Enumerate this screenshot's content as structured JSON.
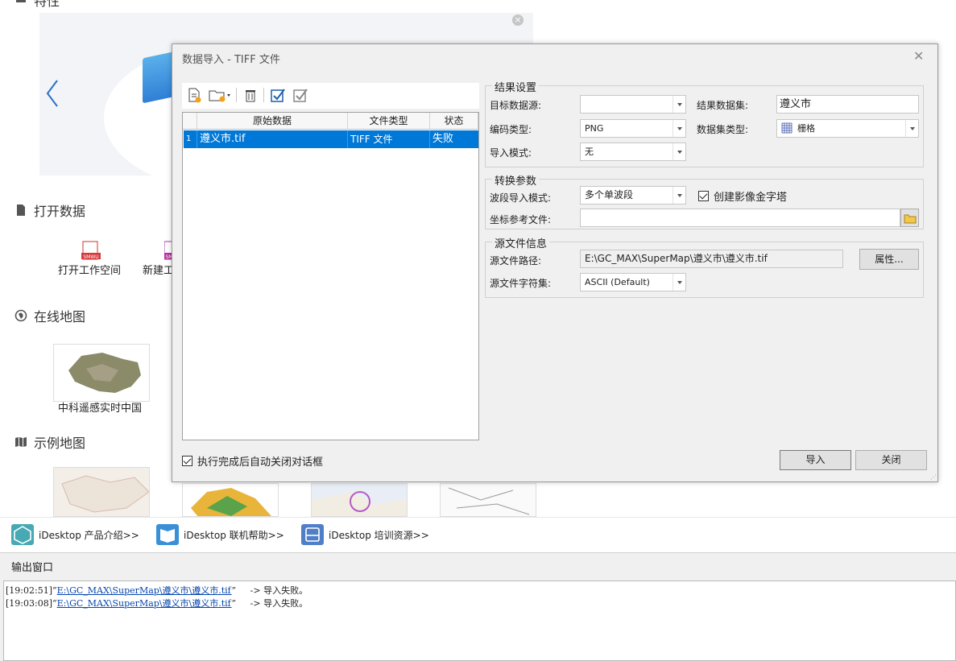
{
  "start_page": {
    "features_title": "特性",
    "open_data": {
      "title": "打开数据",
      "tiles": [
        {
          "label": "打开工作空间",
          "icon": "smwu-file-icon",
          "badge": "SMWU"
        },
        {
          "label": "新建工",
          "icon": "new-workspace-icon",
          "badge": "SM"
        }
      ]
    },
    "online_maps": {
      "title": "在线地图",
      "tiles": [
        {
          "label": "中科遥感实时中国"
        }
      ]
    },
    "sample_maps": {
      "title": "示例地图"
    }
  },
  "links_bar": {
    "items": [
      {
        "label": "iDesktop 产品介绍>>",
        "icon": "product-intro-icon",
        "color": "#46a9b3"
      },
      {
        "label": "iDesktop 联机帮助>>",
        "icon": "online-help-icon",
        "color": "#3a8fd6"
      },
      {
        "label": "iDesktop 培训资源>>",
        "icon": "training-resource-icon",
        "color": "#4f7fc6"
      }
    ]
  },
  "output_window": {
    "title": "输出窗口",
    "logs": [
      {
        "time": "[19:02:51]",
        "open_quote": "“",
        "path": "E:\\GC_MAX\\SuperMap\\遵义市\\遵义市.tif",
        "close_quote": "”",
        "message": "     -> 导入失败。"
      },
      {
        "time": "[19:03:08]",
        "open_quote": "“",
        "path": "E:\\GC_MAX\\SuperMap\\遵义市\\遵义市.tif",
        "close_quote": "”",
        "message": "     -> 导入失败。"
      }
    ]
  },
  "dialog": {
    "title": "数据导入 - TIFF 文件",
    "toolbar": {
      "add_file": "add-file-icon",
      "add_folder": "add-folder-icon",
      "delete": "delete-icon",
      "select_all": "select-all-icon",
      "select_invert": "select-invert-icon"
    },
    "grid": {
      "headers": [
        "原始数据",
        "文件类型",
        "状态"
      ],
      "rows": [
        {
          "index": "1",
          "name": "遵义市.tif",
          "type": "TIFF 文件",
          "status": "失败"
        }
      ]
    },
    "auto_close_label": "执行完成后自动关闭对话框",
    "auto_close_checked": true,
    "result_settings": {
      "legend": "结果设置",
      "target_datasource_label": "目标数据源:",
      "target_datasource_value": "",
      "result_dataset_label": "结果数据集:",
      "result_dataset_value": "遵义市",
      "encoding_label": "编码类型:",
      "encoding_value": "PNG",
      "dataset_type_label": "数据集类型:",
      "dataset_type_value": "栅格",
      "import_mode_label": "导入模式:",
      "import_mode_value": "无"
    },
    "conversion": {
      "legend": "转换参数",
      "band_mode_label": "波段导入模式:",
      "band_mode_value": "多个单波段",
      "pyramid_label": "创建影像金字塔",
      "pyramid_checked": true,
      "coord_file_label": "坐标参考文件:",
      "coord_file_value": ""
    },
    "source_info": {
      "legend": "源文件信息",
      "path_label": "源文件路径:",
      "path_value": "E:\\GC_MAX\\SuperMap\\遵义市\\遵义市.tif",
      "properties_button": "属性...",
      "charset_label": "源文件字符集:",
      "charset_value": "ASCII (Default)"
    },
    "import_button": "导入",
    "close_button": "关闭"
  }
}
